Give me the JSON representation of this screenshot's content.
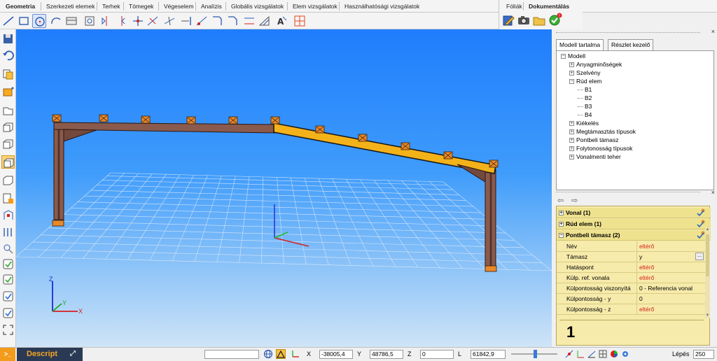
{
  "menu": {
    "tabs": [
      "Geometria",
      "Szerkezeti elemek",
      "Terhek",
      "Tömegek",
      "Végeselem",
      "Analízis",
      "Globális vizsgálatok",
      "Elem vizsgálatok",
      "Használhatósági vizsgálatok"
    ],
    "right_tabs": [
      "Fóliák",
      "Dokumentálás"
    ]
  },
  "toolbar": {
    "icons": [
      "line-tool-icon",
      "rectangle-tool-icon",
      "circle-tool-icon",
      "arc-tool-icon",
      "table-tool-icon",
      "object-tool-icon",
      "mirror-tool-icon",
      "rotate-tool-icon",
      "move-tool-icon",
      "split-tool-icon",
      "intersect-tool-icon",
      "extend-tool-icon",
      "point-tool-icon",
      "fillet-tool-icon",
      "chamfer-tool-icon",
      "offset-tool-icon",
      "dimension-tool-icon",
      "text-tool-icon",
      "grid-tool-icon"
    ],
    "selected_index": 2
  },
  "left_toolbar": {
    "icons": [
      "save-icon",
      "undo-icon",
      "copy-icon",
      "select-box-icon",
      "view-front-icon",
      "view-iso-icon",
      "view-3d-icon",
      "view-perspective-icon",
      "view-section-icon",
      "show-nodes-icon",
      "show-members-icon",
      "zoom-extents-icon",
      "label-icon",
      "check-1-icon",
      "check-2-icon",
      "check-3-icon",
      "check-4-icon",
      "fullscreen-icon"
    ],
    "selected_index": 7
  },
  "model_panel": {
    "tabs": [
      "Modell tartalma",
      "Részlet kezelő"
    ],
    "tree": [
      {
        "label": "Modell",
        "level": 0,
        "expander": "-"
      },
      {
        "label": "Anyagminőségek",
        "level": 1,
        "expander": "+"
      },
      {
        "label": "Szelvény",
        "level": 1,
        "expander": "+"
      },
      {
        "label": "Rúd elem",
        "level": 1,
        "expander": "-"
      },
      {
        "label": "B1",
        "level": 2,
        "expander": ""
      },
      {
        "label": "B2",
        "level": 2,
        "expander": ""
      },
      {
        "label": "B3",
        "level": 2,
        "expander": ""
      },
      {
        "label": "B4",
        "level": 2,
        "expander": ""
      },
      {
        "label": "Kiékelés",
        "level": 1,
        "expander": "+"
      },
      {
        "label": "Megtámasztás típusok",
        "level": 1,
        "expander": "+"
      },
      {
        "label": "Pontbeli támasz",
        "level": 1,
        "expander": "+"
      },
      {
        "label": "Folytonosság típusok",
        "level": 1,
        "expander": "+"
      },
      {
        "label": "Vonalmenti teher",
        "level": 1,
        "expander": "+"
      }
    ]
  },
  "property_panel": {
    "groups": [
      {
        "label": "Vonal (1)",
        "expander": "+"
      },
      {
        "label": "Rúd elem (1)",
        "expander": "+"
      },
      {
        "label": "Pontbeli támasz (2)",
        "expander": "-"
      }
    ],
    "rows": [
      {
        "key": "Név",
        "value": "eltérő",
        "red": true
      },
      {
        "key": "Támasz",
        "value": "y",
        "red": false,
        "button": "..."
      },
      {
        "key": "Hatáspont",
        "value": "eltérő",
        "red": true
      },
      {
        "key": "Külp. ref. vonala",
        "value": "eltérő",
        "red": true
      },
      {
        "key": "Külpontosság viszonyítás",
        "value": "0 - Referencia vonal",
        "red": false
      },
      {
        "key": "Külpontosság - y",
        "value": "0",
        "red": false
      },
      {
        "key": "Külpontosság - z",
        "value": "eltérő",
        "red": true
      }
    ],
    "big_number": "1"
  },
  "status": {
    "descript_label": "Descript",
    "prompt_icon": ">_",
    "coord_labels": {
      "x": "X",
      "y": "Y",
      "z": "Z",
      "l": "L"
    },
    "x": "-38005,4",
    "y": "48786,5",
    "z": "0",
    "l": "61842,9",
    "step_label": "Lépés",
    "step_value": "250"
  },
  "viewport": {
    "axis_labels": {
      "x": "X",
      "y": "Y",
      "z": "Z"
    },
    "colors": {
      "frame": "#8a5a4c",
      "selected_beam": "#f4b21a",
      "support": "#e8892a"
    }
  }
}
